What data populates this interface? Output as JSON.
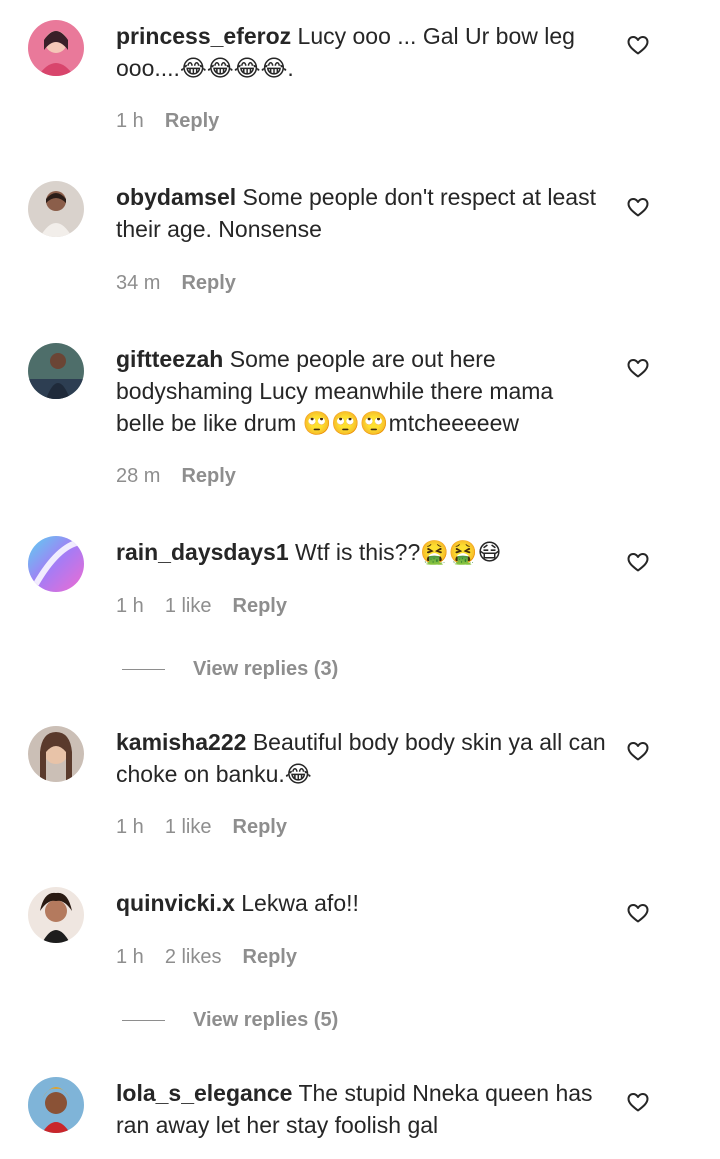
{
  "comments": [
    {
      "username": "princess_eferoz",
      "text": "Lucy ooo ... Gal Ur bow leg ooo....😂😂😂😂.",
      "time": "1 h",
      "likes": "",
      "reply_label": "Reply",
      "avatar_color": "#d8456c"
    },
    {
      "username": "obydamsel",
      "text": "Some people don't respect at least their age. Nonsense",
      "time": "34 m",
      "likes": "",
      "reply_label": "Reply",
      "avatar_color": "#b9a9a2"
    },
    {
      "username": "giftteezah",
      "text": "Some people are out here bodyshaming Lucy meanwhile there mama belle be like drum 🙄🙄🙄mtcheeeeew",
      "time": "28 m",
      "likes": "",
      "reply_label": "Reply",
      "avatar_color": "#5a6a78"
    },
    {
      "username": "rain_daysdays1",
      "text": "Wtf is this??🤮🤮😷",
      "time": "1 h",
      "likes": "1 like",
      "reply_label": "Reply",
      "avatar_color": "#8a6cf0"
    },
    {
      "username": "kamisha222",
      "text": "Beautiful body body skin ya all can choke on banku.😂",
      "time": "1 h",
      "likes": "1 like",
      "reply_label": "Reply",
      "avatar_color": "#8b6a5a"
    },
    {
      "username": "quinvicki.x",
      "text": "Lekwa afo!!",
      "time": "1 h",
      "likes": "2 likes",
      "reply_label": "Reply",
      "avatar_color": "#c79a7c"
    },
    {
      "username": "lola_s_elegance",
      "text": "The stupid Nneka queen has ran away let her stay foolish gal",
      "time": "",
      "likes": "",
      "reply_label": "",
      "avatar_color": "#d98b2b"
    }
  ],
  "view_replies": [
    {
      "label": "View replies (3)"
    },
    {
      "label": "View replies (5)"
    }
  ],
  "icons": {
    "heart": "heart-outline-icon"
  },
  "colors": {
    "text": "#262626",
    "secondary": "#8e8e8e"
  }
}
